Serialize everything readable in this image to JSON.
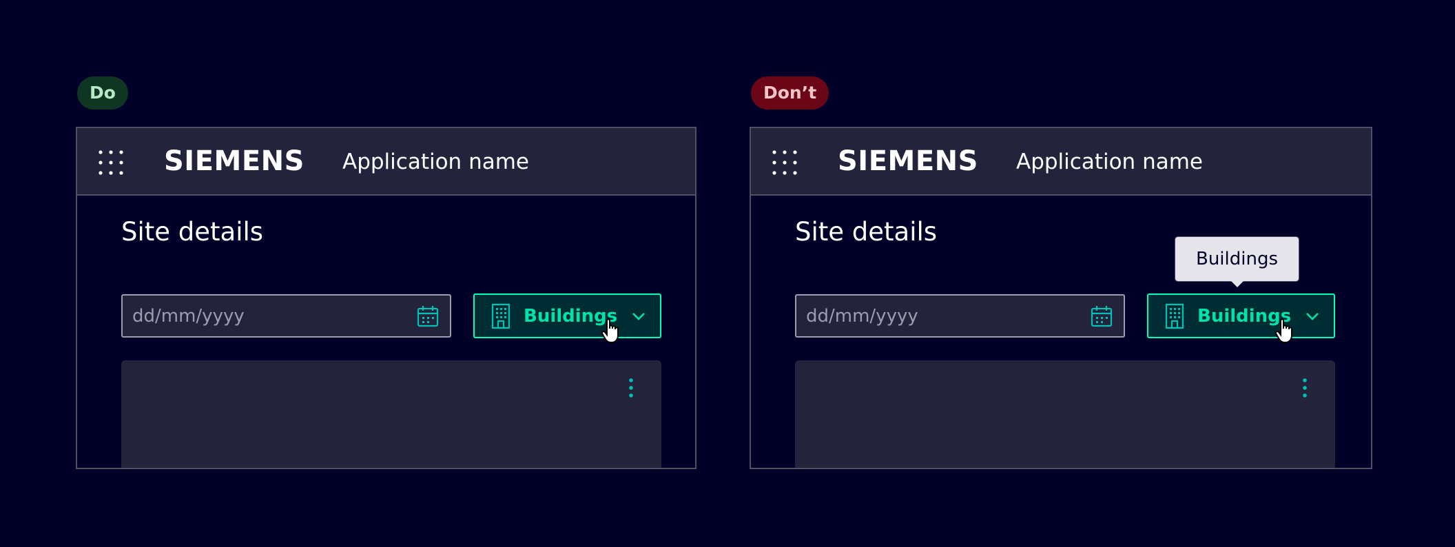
{
  "examples": [
    {
      "badge": "Do",
      "header": {
        "logo": "SIEMENS",
        "app_name": "Application name"
      },
      "page_title": "Site details",
      "date_input": {
        "placeholder": "dd/mm/yyyy"
      },
      "button": {
        "label": "Buildings"
      }
    },
    {
      "badge": "Don’t",
      "header": {
        "logo": "SIEMENS",
        "app_name": "Application name"
      },
      "page_title": "Site details",
      "date_input": {
        "placeholder": "dd/mm/yyyy"
      },
      "button": {
        "label": "Buildings"
      },
      "tooltip": {
        "text": "Buildings"
      }
    }
  ],
  "icons": {
    "apps": "apps-icon",
    "calendar": "calendar-icon",
    "building": "building-icon",
    "chevron": "chevron-down-icon",
    "cursor": "hand-cursor-icon",
    "more": "kebab-menu-icon"
  },
  "colors": {
    "background": "#000028",
    "surface": "#23233c",
    "accent": "#00e3a8",
    "button_border": "#00ffb9",
    "icon_teal": "#00c1b6",
    "do_badge_bg": "#0f3523",
    "do_badge_text": "#b6e9c8",
    "dont_badge_bg": "#6a0616",
    "dont_badge_text": "#f4c4ca",
    "tooltip_bg": "#e5e5eb"
  }
}
